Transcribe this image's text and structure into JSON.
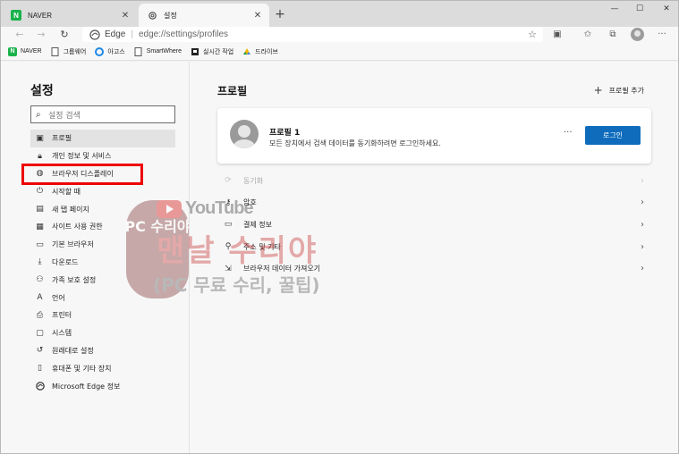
{
  "tabs": [
    {
      "label": "NAVER",
      "favicon": "naver-icon"
    },
    {
      "label": "설정",
      "favicon": "gear-icon"
    }
  ],
  "address": {
    "site": "Edge",
    "url": "edge://settings/profiles"
  },
  "bookmarks": [
    {
      "label": "NAVER",
      "icon": "naver-icon"
    },
    {
      "label": "그룹웨어",
      "icon": "document-icon"
    },
    {
      "label": "아고스",
      "icon": "circle-icon"
    },
    {
      "label": "SmartWhere",
      "icon": "document-icon"
    },
    {
      "label": "실시간 작업",
      "icon": "bookmark-icon"
    },
    {
      "label": "드라이브",
      "icon": "drive-icon"
    }
  ],
  "sidebar": {
    "title": "설정",
    "search_placeholder": "설정 검색",
    "items": [
      {
        "label": "프로필",
        "icon": "profile-icon"
      },
      {
        "label": "개인 정보 및 서비스",
        "icon": "lock-icon"
      },
      {
        "label": "브라우저 디스플레이",
        "icon": "palette-icon"
      },
      {
        "label": "시작할 때",
        "icon": "power-icon"
      },
      {
        "label": "새 탭 페이지",
        "icon": "newtab-icon"
      },
      {
        "label": "사이트 사용 권한",
        "icon": "permissions-icon"
      },
      {
        "label": "기본 브라우저",
        "icon": "browser-icon"
      },
      {
        "label": "다운로드",
        "icon": "download-icon"
      },
      {
        "label": "가족 보호 설정",
        "icon": "family-icon"
      },
      {
        "label": "언어",
        "icon": "language-icon"
      },
      {
        "label": "프린터",
        "icon": "printer-icon"
      },
      {
        "label": "시스템",
        "icon": "system-icon"
      },
      {
        "label": "원래대로 설정",
        "icon": "reset-icon"
      },
      {
        "label": "휴대폰 및 기타 장치",
        "icon": "phone-icon"
      },
      {
        "label": "Microsoft Edge 정보",
        "icon": "edge-icon"
      }
    ]
  },
  "main": {
    "title": "프로필",
    "add_profile": "프로필 추가",
    "profile": {
      "name": "프로필 1",
      "description": "모든 장치에서 검색 데이터를 동기화하려면 로그인하세요.",
      "login_button": "로그인",
      "more": "···"
    },
    "rows": [
      {
        "label": "동기화",
        "icon": "sync-icon",
        "disabled": true
      },
      {
        "label": "암호",
        "icon": "key-icon",
        "disabled": false
      },
      {
        "label": "결제 정보",
        "icon": "card-icon",
        "disabled": false
      },
      {
        "label": "주소 및 기타",
        "icon": "location-icon",
        "disabled": false
      },
      {
        "label": "브라우저 데이터 가져오기",
        "icon": "import-icon",
        "disabled": false
      }
    ]
  },
  "watermark": {
    "badge_text": "PC 수리야",
    "youtube": "YouTube",
    "title": "맨날 수리야",
    "subtitle": "(PC 무료 수리, 꿀팁)"
  }
}
